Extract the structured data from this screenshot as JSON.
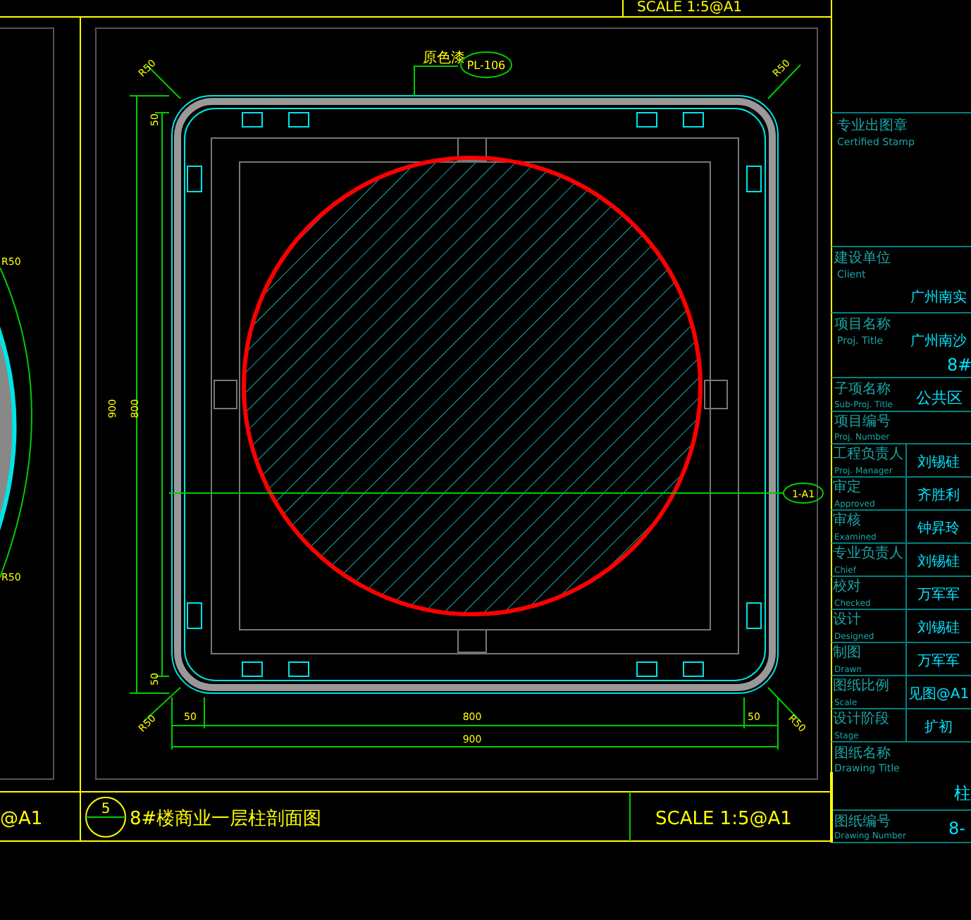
{
  "top_scale": "SCALE 1:5@A1",
  "left_panel": {
    "scale_fragment": "@A1",
    "radii": [
      "R50",
      "R50"
    ]
  },
  "section": {
    "material_label": "原色漆",
    "material_tag": "PL-106",
    "section_tag": "1-A1",
    "corner_radii": [
      "R50",
      "R50",
      "R50",
      "R50"
    ],
    "left_dims": [
      {
        "text": "50",
        "kind": "end"
      },
      {
        "text": "900",
        "kind": "outer"
      },
      {
        "text": "800",
        "kind": "inner"
      },
      {
        "text": "50",
        "kind": "end"
      }
    ],
    "bottom_dims": [
      "50",
      "800",
      "50",
      "900"
    ]
  },
  "caption": {
    "number": "5",
    "title": "8#楼商业一层柱剖面图",
    "scale": "SCALE 1:5@A1"
  },
  "title_block": {
    "stamp": {
      "label_cn": "专业出图章",
      "label_en": "Certified Stamp"
    },
    "client": {
      "label_cn": "建设单位",
      "label_en": "Client",
      "value": "广州南实"
    },
    "project": {
      "label_cn": "项目名称",
      "label_en": "Proj. Title",
      "value": "广州南沙",
      "value_2": "8#"
    },
    "sub_project": {
      "label_cn": "子项名称",
      "label_en": "Sub-Proj. Title",
      "value": "公共区"
    },
    "project_number": {
      "label_cn": "项目编号",
      "label_en": "Proj. Number"
    },
    "people": [
      {
        "label_cn": "工程负责人",
        "label_en": "Proj. Manager",
        "value": "刘锡硅"
      },
      {
        "label_cn": "审定",
        "label_en": "Approved",
        "value": "齐胜利"
      },
      {
        "label_cn": "审核",
        "label_en": "Examined",
        "value": "钟昇玲"
      },
      {
        "label_cn": "专业负责人",
        "label_en": "Chief",
        "value": "刘锡硅"
      },
      {
        "label_cn": "校对",
        "label_en": "Checked",
        "value": "万军军"
      },
      {
        "label_cn": "设计",
        "label_en": "Designed",
        "value": "刘锡硅"
      },
      {
        "label_cn": "制图",
        "label_en": "Drawn",
        "value": "万军军"
      },
      {
        "label_cn": "图纸比例",
        "label_en": "Scale",
        "value": "见图@A1"
      },
      {
        "label_cn": "设计阶段",
        "label_en": "Stage",
        "value": "扩初"
      }
    ],
    "drawing_title": {
      "label_cn": "图纸名称",
      "label_en": "Drawing Title",
      "value": "柱"
    },
    "drawing_number": {
      "label_cn": "图纸编号",
      "label_en": "Drawing Number",
      "value": "8-"
    }
  }
}
